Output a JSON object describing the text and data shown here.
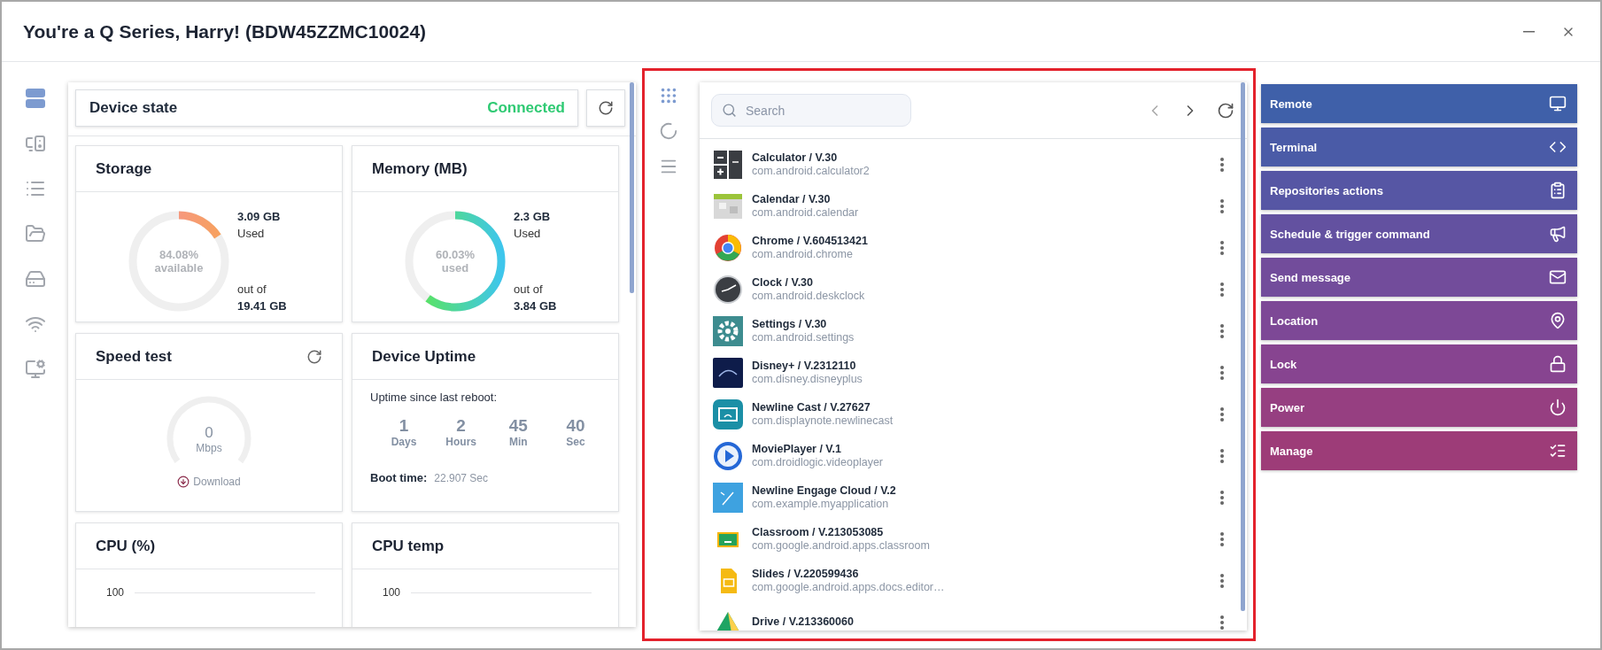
{
  "window": {
    "title": "You're a Q Series, Harry! (BDW45ZZMC10024)"
  },
  "sidebar": {
    "items": [
      {
        "selected": true
      },
      {
        "selected": false
      },
      {
        "selected": false
      },
      {
        "selected": false
      },
      {
        "selected": false
      },
      {
        "selected": false
      },
      {
        "selected": false
      }
    ]
  },
  "device_state": {
    "label": "Device state",
    "status": "Connected"
  },
  "storage": {
    "title": "Storage",
    "level": 0.1592,
    "center_value": "84.08%",
    "center_label": "available",
    "used_value": "3.09 GB",
    "used_label": "Used",
    "total_label": "out of",
    "total_value": "19.41 GB"
  },
  "memory": {
    "title": "Memory (MB)",
    "level": 0.6003,
    "center_value": "60.03%",
    "center_label": "used",
    "used_value": "2.3 GB",
    "used_label": "Used",
    "total_label": "out of",
    "total_value": "3.84 GB"
  },
  "speed_test": {
    "title": "Speed test",
    "value": "0",
    "unit": "Mbps",
    "direction": "Download"
  },
  "uptime": {
    "title": "Device Uptime",
    "caption": "Uptime since last reboot:",
    "units": [
      {
        "value": "1",
        "label": "Days"
      },
      {
        "value": "2",
        "label": "Hours"
      },
      {
        "value": "45",
        "label": "Min"
      },
      {
        "value": "40",
        "label": "Sec"
      }
    ],
    "boot_label": "Boot time:",
    "boot_value": "22.907 Sec"
  },
  "cpu": {
    "title": "CPU (%)",
    "tick": "100"
  },
  "cpu_temp": {
    "title": "CPU temp",
    "tick": "100"
  },
  "app_tools": {
    "items": [
      {
        "selected": true
      },
      {
        "selected": false
      },
      {
        "selected": false
      }
    ]
  },
  "apps": {
    "search": {
      "placeholder": "Search"
    },
    "items": [
      {
        "name": "Calculator / V.30",
        "package": "com.android.calculator2"
      },
      {
        "name": "Calendar / V.30",
        "package": "com.android.calendar"
      },
      {
        "name": "Chrome / V.604513421",
        "package": "com.android.chrome"
      },
      {
        "name": "Clock / V.30",
        "package": "com.android.deskclock"
      },
      {
        "name": "Settings / V.30",
        "package": "com.android.settings"
      },
      {
        "name": "Disney+ / V.2312110",
        "package": "com.disney.disneyplus"
      },
      {
        "name": "Newline Cast / V.27627",
        "package": "com.displaynote.newlinecast"
      },
      {
        "name": "MoviePlayer / V.1",
        "package": "com.droidlogic.videoplayer"
      },
      {
        "name": "Newline Engage Cloud / V.2",
        "package": "com.example.myapplication"
      },
      {
        "name": "Classroom / V.213053085",
        "package": "com.google.android.apps.classroom"
      },
      {
        "name": "Slides / V.220599436",
        "package": "com.google.android.apps.docs.editor…"
      },
      {
        "name": "Drive / V.213360060"
      }
    ]
  },
  "actions": [
    {
      "label": "Remote",
      "color": "#3f60a9"
    },
    {
      "label": "Terminal",
      "color": "#4a5ba7"
    },
    {
      "label": "Repositories actions",
      "color": "#5656a4"
    },
    {
      "label": "Schedule & trigger command",
      "color": "#6351a0"
    },
    {
      "label": "Send message",
      "color": "#724c9b"
    },
    {
      "label": "Location",
      "color": "#7d4896"
    },
    {
      "label": "Lock",
      "color": "#874490"
    },
    {
      "label": "Power",
      "color": "#963f81"
    },
    {
      "label": "Manage",
      "color": "#9d3c78"
    }
  ]
}
